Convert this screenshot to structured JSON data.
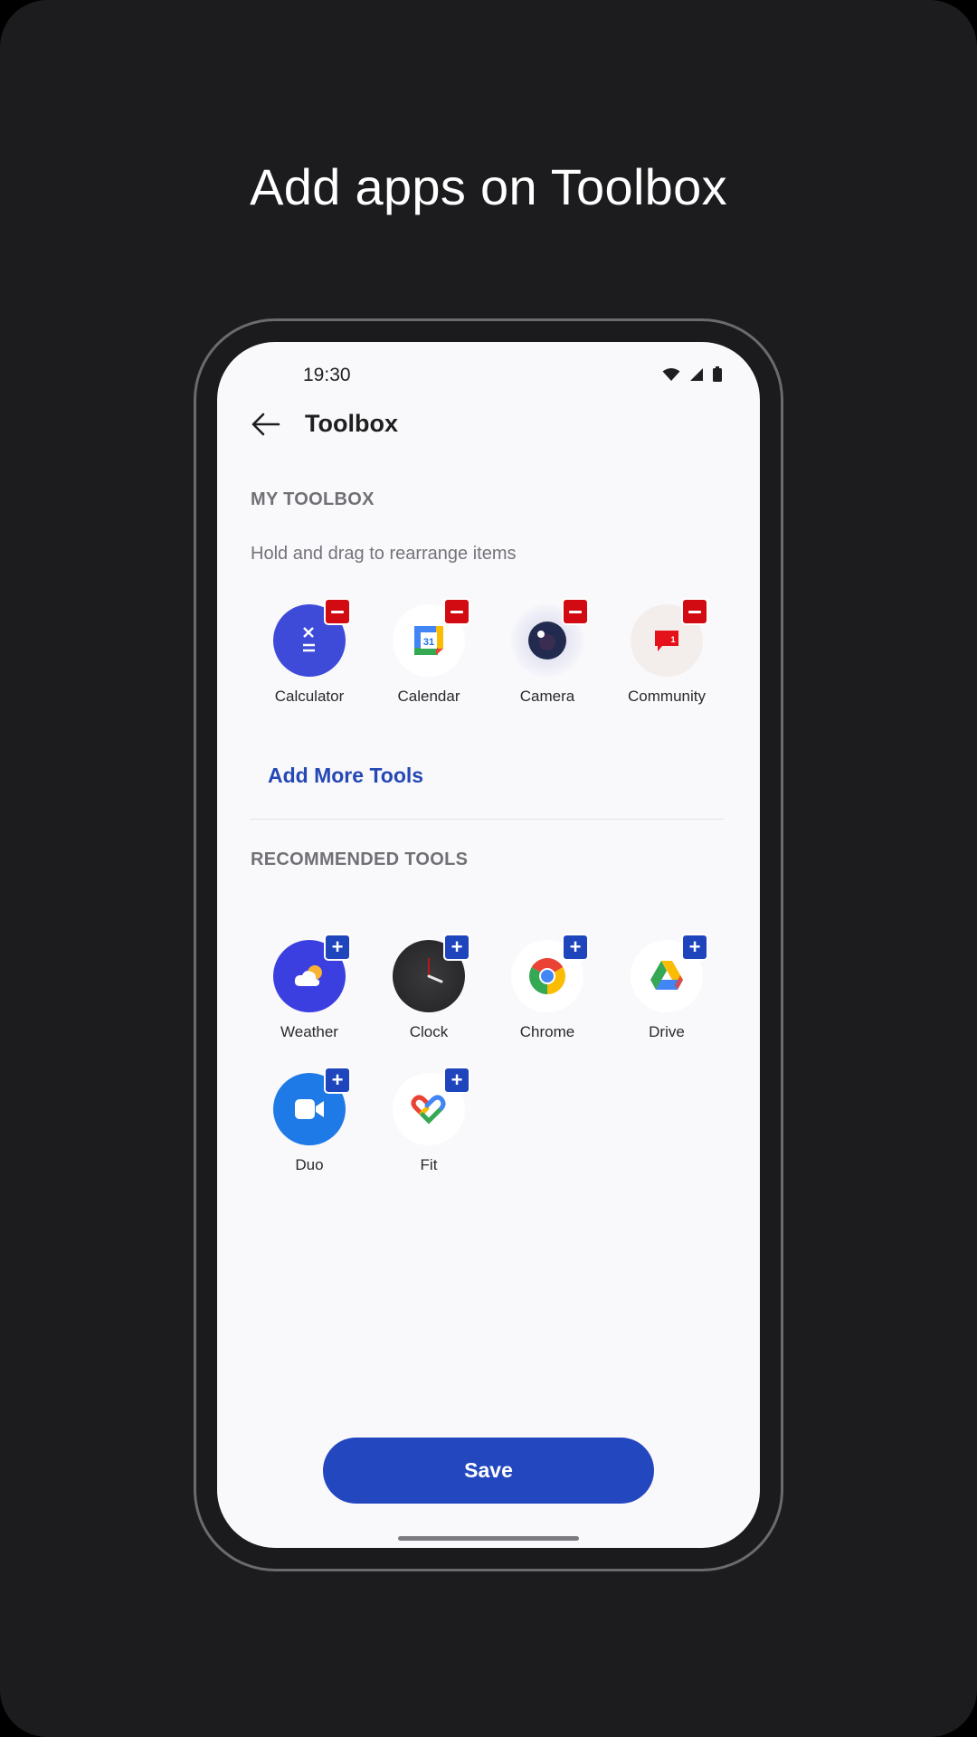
{
  "headline": "Add apps on Toolbox",
  "status_bar": {
    "time": "19:30",
    "icons": [
      "wifi-icon",
      "cellular-signal-icon",
      "battery-icon"
    ]
  },
  "app_bar": {
    "back_icon": "arrow-left-icon",
    "title": "Toolbox"
  },
  "my_toolbox": {
    "heading": "MY TOOLBOX",
    "hint": "Hold and drag to rearrange items",
    "action_icon": "remove-icon",
    "tools": [
      {
        "label": "Calculator",
        "icon": "calculator-icon"
      },
      {
        "label": "Calendar",
        "icon": "calendar-icon",
        "icon_text": "31"
      },
      {
        "label": "Camera",
        "icon": "camera-icon"
      },
      {
        "label": "Community",
        "icon": "community-icon",
        "icon_text": "1"
      }
    ],
    "add_more_label": "Add More Tools"
  },
  "recommended": {
    "heading": "RECOMMENDED TOOLS",
    "action_icon": "add-icon",
    "tools": [
      {
        "label": "Weather",
        "icon": "weather-icon"
      },
      {
        "label": "Clock",
        "icon": "clock-icon"
      },
      {
        "label": "Chrome",
        "icon": "chrome-icon"
      },
      {
        "label": "Drive",
        "icon": "drive-icon"
      },
      {
        "label": "Duo",
        "icon": "duo-icon"
      },
      {
        "label": "Fit",
        "icon": "fit-icon"
      }
    ]
  },
  "save_label": "Save",
  "colors": {
    "accent": "#2347bf",
    "remove_badge": "#d20b12",
    "add_badge": "#1f45bd",
    "background": "#1c1b1e",
    "screen": "#f9f8fb"
  }
}
